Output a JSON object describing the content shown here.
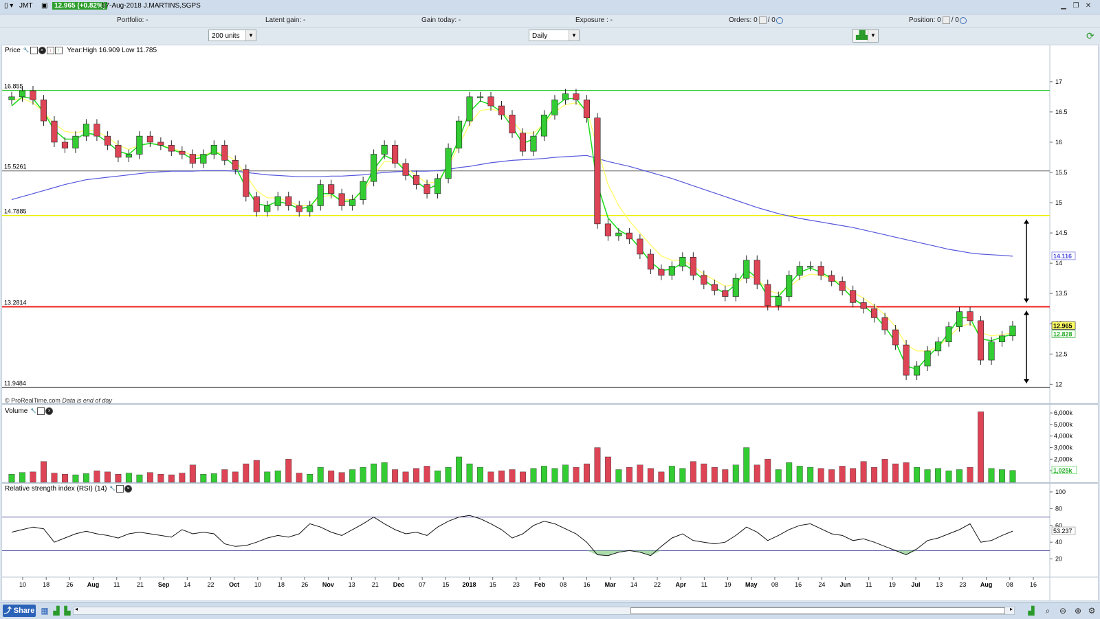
{
  "titlebar": {
    "ticker": "JMT",
    "price_badge": "12.965 (+0.82%)",
    "date_name": "07-Aug-2018 J.MARTINS,SGPS",
    "window_buttons": [
      "minimize-icon",
      "restore-icon",
      "close-icon"
    ]
  },
  "portfolio_bar": {
    "portfolio": "Portfolio: -",
    "latent_gain": "Latent gain: -",
    "gain_today": "Gain today: -",
    "exposure": "Exposure : -",
    "orders": "Orders: 0",
    "orders_sep": "/ 0",
    "position": "Position: 0",
    "position_sep": "/ 0"
  },
  "controls": {
    "units_select": "200 units",
    "period_select": "Daily"
  },
  "price_panel": {
    "title": "Price",
    "yearinfo": "Year:High 16.909 Low 11.785",
    "copyright": "© ProRealTime.com",
    "eod_note": "Data is end of day",
    "level_labels": [
      "16.855",
      "15.5261",
      "14.7885",
      "13.2814",
      "11.9484"
    ],
    "level_values": [
      16.855,
      15.5261,
      14.7885,
      13.2814,
      11.9484
    ],
    "level_colors": [
      "#33cc33",
      "#888888",
      "#eeee00",
      "#ee2222",
      "#333333"
    ],
    "y_ticks": [
      "17",
      "16.5",
      "16",
      "15.5",
      "15",
      "14.5",
      "14",
      "13.5",
      "13",
      "12.5",
      "12"
    ],
    "y_tick_values": [
      17,
      16.5,
      16,
      15.5,
      15,
      14.5,
      14,
      13.5,
      13,
      12.5,
      12
    ],
    "ylim": [
      11.72,
      17.35
    ],
    "tags": [
      {
        "text": "14.116",
        "value": 14.116,
        "bg": "#ffffff",
        "fg": "#4a4adf"
      },
      {
        "text": "12.965",
        "value": 12.965,
        "bg": "#ffff66",
        "fg": "#000000"
      },
      {
        "text": "12.828",
        "value": 12.828,
        "bg": "#ffffff",
        "fg": "#22aa22"
      }
    ]
  },
  "volume_panel": {
    "title": "Volume",
    "y_ticks": [
      "6,000k",
      "5,000k",
      "4,000k",
      "3,000k",
      "2,000k",
      "1,000k"
    ],
    "y_tick_values": [
      6000,
      5000,
      4000,
      3000,
      2000,
      1000
    ],
    "ylim": [
      0,
      6300
    ],
    "last_tag": "1,025k",
    "last_value": 1025
  },
  "rsi_panel": {
    "title": "Relative strength index (RSI) (14)",
    "y_ticks": [
      "100",
      "80",
      "60",
      "40",
      "20"
    ],
    "y_tick_values": [
      100,
      80,
      60,
      40,
      20
    ],
    "ylim": [
      0,
      100
    ],
    "upper": 70,
    "lower": 30,
    "last_tag": "53.237",
    "last_value": 53.237
  },
  "x_axis": {
    "labels": [
      "10",
      "18",
      "26",
      "Aug",
      "11",
      "21",
      "Sep",
      "14",
      "22",
      "Oct",
      "10",
      "18",
      "26",
      "Nov",
      "13",
      "21",
      "Dec",
      "07",
      "15",
      "2018",
      "15",
      "23",
      "Feb",
      "08",
      "16",
      "Mar",
      "14",
      "22",
      "Apr",
      "11",
      "19",
      "May",
      "08",
      "16",
      "24",
      "Jun",
      "11",
      "19",
      "Jul",
      "13",
      "23",
      "Aug",
      "08",
      "16"
    ],
    "bold": [
      "Aug",
      "Sep",
      "Oct",
      "Nov",
      "Dec",
      "2018",
      "Feb",
      "Mar",
      "Apr",
      "May",
      "Jun",
      "Jul"
    ]
  },
  "bottombar": {
    "share_label": "Share"
  },
  "colors": {
    "up": "#33cc33",
    "down": "#dd4455",
    "ma_fast": "#22dd22",
    "ma_mid": "#ffff66",
    "ma_slow": "#5555dd"
  },
  "chart_data": [
    {
      "type": "candlestick",
      "title": "Price",
      "series": [
        {
          "name": "Price",
          "close": [
            16.75,
            16.85,
            16.7,
            16.35,
            16.0,
            15.9,
            16.1,
            16.3,
            16.1,
            15.95,
            15.75,
            15.8,
            16.1,
            16.0,
            15.95,
            15.85,
            15.8,
            15.65,
            15.8,
            15.95,
            15.7,
            15.55,
            15.1,
            14.85,
            14.95,
            15.1,
            14.95,
            14.85,
            14.95,
            15.3,
            15.15,
            14.95,
            15.05,
            15.35,
            15.8,
            15.95,
            15.65,
            15.45,
            15.3,
            15.15,
            15.4,
            15.9,
            16.35,
            16.75,
            16.75,
            16.6,
            16.45,
            16.15,
            15.85,
            16.1,
            16.45,
            16.7,
            16.8,
            16.7,
            16.4,
            14.65,
            14.45,
            14.5,
            14.4,
            14.15,
            13.9,
            13.8,
            13.95,
            14.1,
            13.8,
            13.65,
            13.55,
            13.45,
            13.75,
            14.05,
            13.65,
            13.3,
            13.45,
            13.8,
            13.95,
            13.95,
            13.8,
            13.7,
            13.55,
            13.35,
            13.25,
            13.1,
            12.9,
            12.65,
            12.15,
            12.3,
            12.55,
            12.7,
            12.95,
            13.2,
            13.05,
            12.4,
            12.7,
            12.8,
            12.965
          ]
        }
      ],
      "ma_fast": [
        16.6,
        16.75,
        16.72,
        16.5,
        16.2,
        16.05,
        16.05,
        16.15,
        16.12,
        16.0,
        15.85,
        15.8,
        15.95,
        15.98,
        15.95,
        15.88,
        15.82,
        15.72,
        15.75,
        15.85,
        15.75,
        15.6,
        15.25,
        14.98,
        14.95,
        15.02,
        14.98,
        14.9,
        14.93,
        15.15,
        15.15,
        15.02,
        15.03,
        15.22,
        15.55,
        15.78,
        15.7,
        15.52,
        15.35,
        15.22,
        15.3,
        15.65,
        16.05,
        16.5,
        16.68,
        16.62,
        16.5,
        16.25,
        15.98,
        16.05,
        16.32,
        16.58,
        16.72,
        16.72,
        16.5,
        15.3,
        14.75,
        14.55,
        14.45,
        14.25,
        14.02,
        13.88,
        13.9,
        14.0,
        13.88,
        13.72,
        13.6,
        13.5,
        13.65,
        13.9,
        13.75,
        13.45,
        13.45,
        13.65,
        13.85,
        13.92,
        13.85,
        13.75,
        13.6,
        13.42,
        13.3,
        13.15,
        12.95,
        12.7,
        12.3,
        12.25,
        12.45,
        12.62,
        12.85,
        13.1,
        13.1,
        12.75,
        12.72,
        12.78,
        12.828
      ],
      "ma_mid": [
        16.7,
        16.72,
        16.65,
        16.5,
        16.3,
        16.18,
        16.15,
        16.2,
        16.18,
        16.08,
        15.95,
        15.88,
        15.95,
        15.98,
        15.95,
        15.9,
        15.85,
        15.78,
        15.78,
        15.85,
        15.8,
        15.7,
        15.45,
        15.2,
        15.08,
        15.08,
        15.02,
        14.95,
        14.95,
        15.1,
        15.12,
        15.05,
        15.05,
        15.18,
        15.45,
        15.68,
        15.68,
        15.58,
        15.45,
        15.32,
        15.35,
        15.6,
        15.95,
        16.3,
        16.52,
        16.55,
        16.5,
        16.35,
        16.15,
        16.15,
        16.3,
        16.5,
        16.62,
        16.65,
        16.55,
        15.9,
        15.3,
        14.95,
        14.7,
        14.5,
        14.3,
        14.12,
        14.05,
        14.05,
        13.95,
        13.82,
        13.72,
        13.62,
        13.65,
        13.8,
        13.75,
        13.55,
        13.5,
        13.6,
        13.75,
        13.82,
        13.8,
        13.75,
        13.65,
        13.52,
        13.42,
        13.3,
        13.15,
        12.95,
        12.65,
        12.55,
        12.55,
        12.62,
        12.78,
        12.95,
        13.0,
        12.85,
        12.8,
        12.82,
        12.85
      ],
      "ma_slow": [
        15.05,
        15.1,
        15.15,
        15.2,
        15.25,
        15.3,
        15.34,
        15.38,
        15.4,
        15.42,
        15.44,
        15.46,
        15.48,
        15.5,
        15.51,
        15.52,
        15.52,
        15.52,
        15.53,
        15.53,
        15.53,
        15.52,
        15.5,
        15.48,
        15.46,
        15.45,
        15.44,
        15.43,
        15.43,
        15.43,
        15.44,
        15.44,
        15.45,
        15.46,
        15.48,
        15.5,
        15.51,
        15.52,
        15.52,
        15.52,
        15.53,
        15.55,
        15.58,
        15.6,
        15.63,
        15.66,
        15.68,
        15.7,
        15.71,
        15.72,
        15.73,
        15.75,
        15.76,
        15.77,
        15.78,
        15.73,
        15.68,
        15.64,
        15.6,
        15.55,
        15.5,
        15.45,
        15.4,
        15.34,
        15.28,
        15.22,
        15.16,
        15.1,
        15.04,
        14.98,
        14.92,
        14.87,
        14.82,
        14.78,
        14.74,
        14.71,
        14.68,
        14.65,
        14.62,
        14.59,
        14.55,
        14.51,
        14.47,
        14.43,
        14.39,
        14.35,
        14.31,
        14.27,
        14.23,
        14.2,
        14.17,
        14.15,
        14.14,
        14.13,
        14.116
      ]
    },
    {
      "type": "bar",
      "title": "Volume",
      "series": [
        {
          "name": "Volume",
          "values": [
            700,
            850,
            900,
            1800,
            800,
            700,
            650,
            750,
            1000,
            900,
            700,
            800,
            650,
            850,
            700,
            650,
            800,
            1500,
            700,
            750,
            1100,
            900,
            1600,
            1900,
            900,
            1000,
            2000,
            800,
            700,
            1300,
            1000,
            850,
            1100,
            1300,
            1600,
            1700,
            1100,
            900,
            1200,
            1400,
            1000,
            1300,
            2200,
            1600,
            1300,
            900,
            1000,
            1100,
            900,
            1200,
            1400,
            1200,
            1500,
            1300,
            1600,
            3000,
            2200,
            1100,
            1300,
            1500,
            1200,
            900,
            1400,
            1200,
            1800,
            1600,
            1300,
            1100,
            1500,
            3000,
            1500,
            2000,
            1100,
            1700,
            1400,
            1300,
            1200,
            1100,
            1400,
            1200,
            1800,
            1300,
            2000,
            1600,
            1700,
            1300,
            1100,
            1200,
            1000,
            1100,
            1300,
            6100,
            1200,
            1100,
            1025
          ]
        }
      ]
    },
    {
      "type": "line",
      "title": "Relative strength index (RSI) (14)",
      "series": [
        {
          "name": "RSI",
          "values": [
            52,
            55,
            58,
            56,
            40,
            45,
            50,
            53,
            50,
            48,
            45,
            50,
            52,
            50,
            48,
            46,
            55,
            50,
            52,
            50,
            38,
            35,
            36,
            40,
            45,
            48,
            46,
            50,
            62,
            58,
            52,
            48,
            55,
            62,
            70,
            62,
            55,
            50,
            52,
            48,
            58,
            65,
            70,
            72,
            68,
            62,
            55,
            45,
            50,
            60,
            65,
            62,
            56,
            50,
            40,
            25,
            24,
            28,
            30,
            28,
            24,
            35,
            45,
            50,
            42,
            40,
            38,
            40,
            48,
            58,
            52,
            42,
            48,
            55,
            60,
            62,
            56,
            50,
            48,
            42,
            44,
            40,
            35,
            30,
            25,
            32,
            42,
            45,
            50,
            55,
            62,
            40,
            42,
            48,
            53.237
          ]
        }
      ],
      "ylim": [
        0,
        100
      ]
    }
  ]
}
